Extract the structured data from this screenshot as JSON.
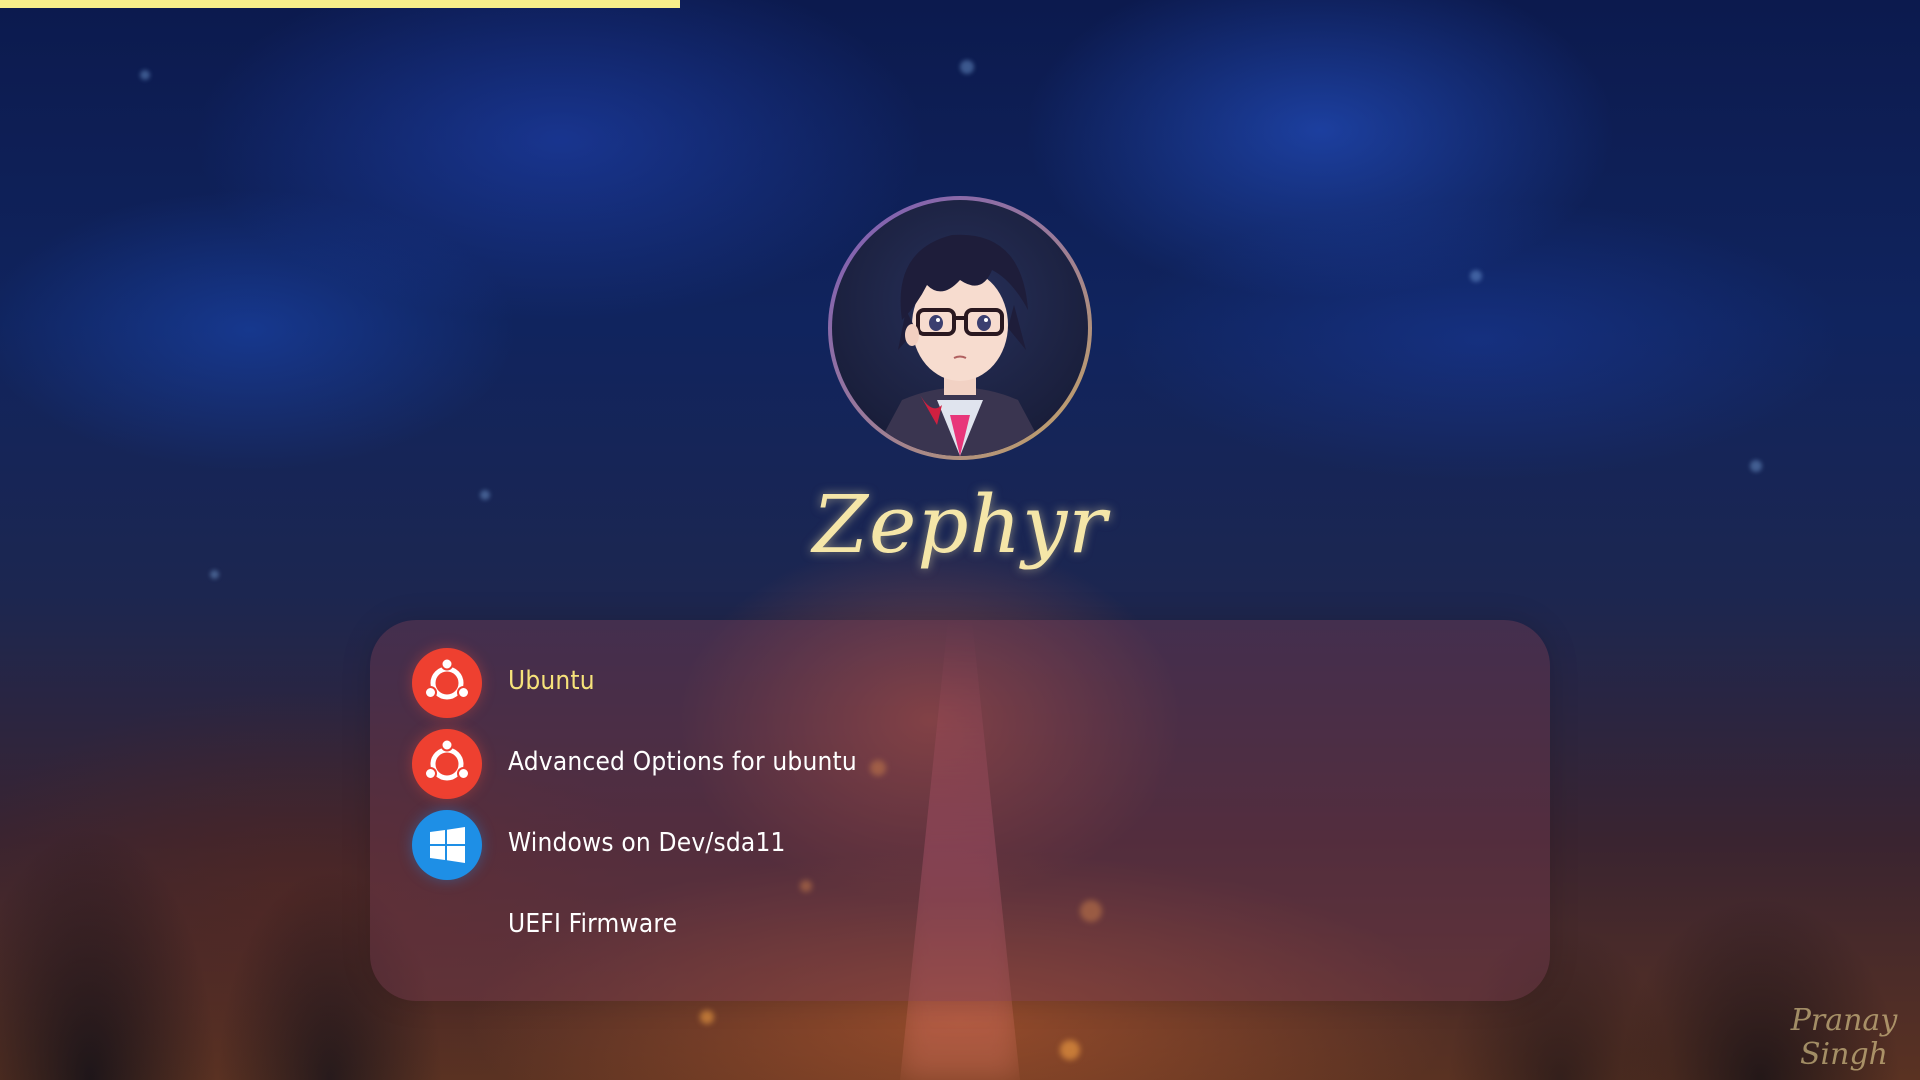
{
  "theme": {
    "name": "Zephyr",
    "accent_color": "#f6e27a",
    "text_color": "#ffffff",
    "progress_color": "#f7ee8a",
    "background_description": "blurred night sky"
  },
  "progress": {
    "fraction": 0.354
  },
  "menu": {
    "selected_index": 0,
    "items": [
      {
        "label": "Ubuntu",
        "icon": "ubuntu-icon",
        "selected": true
      },
      {
        "label": "Advanced Options for ubuntu",
        "icon": "ubuntu-icon",
        "selected": false
      },
      {
        "label": "Windows on Dev/sda11",
        "icon": "windows-icon",
        "selected": false
      },
      {
        "label": "UEFI Firmware",
        "icon": "",
        "selected": false
      }
    ]
  },
  "signature": {
    "line1": "Pranay",
    "line2": "Singh"
  }
}
